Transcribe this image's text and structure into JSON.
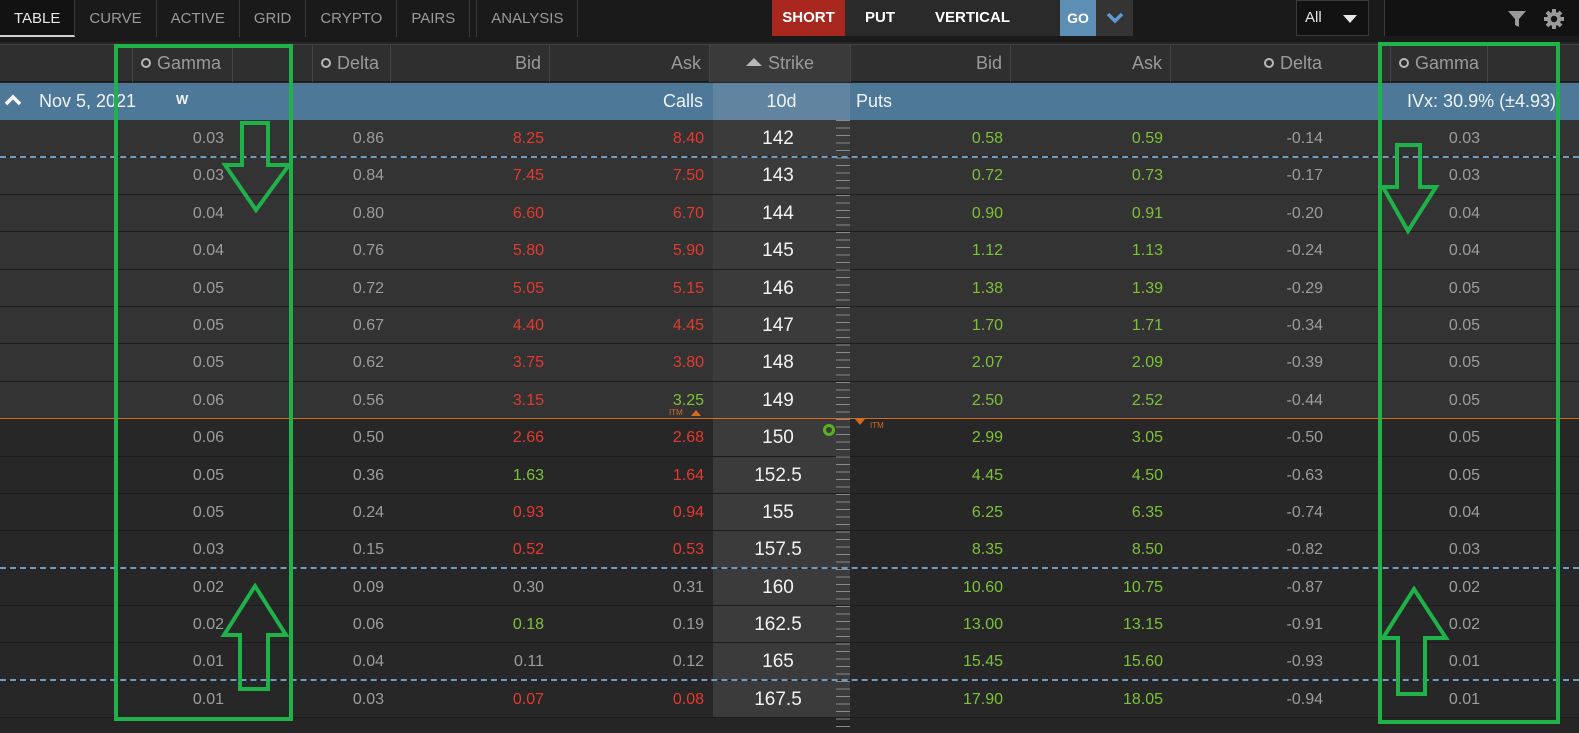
{
  "toolbar": {
    "tabs": [
      "TABLE",
      "CURVE",
      "ACTIVE",
      "GRID",
      "CRYPTO",
      "PAIRS",
      "ANALYSIS"
    ],
    "active_tab": "TABLE",
    "side_label": "SHORT",
    "type_label": "PUT",
    "spread_label": "VERTICAL",
    "go_label": "GO",
    "filter_select": "All"
  },
  "columns": {
    "call_gamma": "Gamma",
    "call_delta": "Delta",
    "call_bid": "Bid",
    "call_ask": "Ask",
    "strike": "Strike",
    "put_bid": "Bid",
    "put_ask": "Ask",
    "put_delta": "Delta",
    "put_gamma": "Gamma"
  },
  "expiration": {
    "date": "Nov 5, 2021",
    "tag": "W",
    "calls_label": "Calls",
    "days_to_exp": "10d",
    "puts_label": "Puts",
    "ivx": "IVx: 30.9% (±4.93)"
  },
  "itm_label": "ITM",
  "colors": {
    "highlight_box": "#1fb14a",
    "bid_ask_red": "#e23a2e",
    "bid_ask_green": "#7cc13a",
    "header_band": "#4e7897",
    "price_line": "#d86a1f"
  },
  "rows": [
    {
      "strike": "142",
      "c_gamma": "0.03",
      "c_delta": "0.86",
      "c_bid": "8.25",
      "c_bid_color": "red",
      "c_ask": "8.40",
      "c_ask_color": "red",
      "p_bid": "0.58",
      "p_ask": "0.59",
      "p_delta": "-0.14",
      "p_gamma": "0.03",
      "itm": true
    },
    {
      "strike": "143",
      "c_gamma": "0.03",
      "c_delta": "0.84",
      "c_bid": "7.45",
      "c_bid_color": "red",
      "c_ask": "7.50",
      "c_ask_color": "red",
      "p_bid": "0.72",
      "p_ask": "0.73",
      "p_delta": "-0.17",
      "p_gamma": "0.03",
      "itm": true
    },
    {
      "strike": "144",
      "c_gamma": "0.04",
      "c_delta": "0.80",
      "c_bid": "6.60",
      "c_bid_color": "red",
      "c_ask": "6.70",
      "c_ask_color": "red",
      "p_bid": "0.90",
      "p_ask": "0.91",
      "p_delta": "-0.20",
      "p_gamma": "0.04",
      "itm": true
    },
    {
      "strike": "145",
      "c_gamma": "0.04",
      "c_delta": "0.76",
      "c_bid": "5.80",
      "c_bid_color": "red",
      "c_ask": "5.90",
      "c_ask_color": "red",
      "p_bid": "1.12",
      "p_ask": "1.13",
      "p_delta": "-0.24",
      "p_gamma": "0.04",
      "itm": true
    },
    {
      "strike": "146",
      "c_gamma": "0.05",
      "c_delta": "0.72",
      "c_bid": "5.05",
      "c_bid_color": "red",
      "c_ask": "5.15",
      "c_ask_color": "red",
      "p_bid": "1.38",
      "p_ask": "1.39",
      "p_delta": "-0.29",
      "p_gamma": "0.05",
      "itm": true
    },
    {
      "strike": "147",
      "c_gamma": "0.05",
      "c_delta": "0.67",
      "c_bid": "4.40",
      "c_bid_color": "red",
      "c_ask": "4.45",
      "c_ask_color": "red",
      "p_bid": "1.70",
      "p_ask": "1.71",
      "p_delta": "-0.34",
      "p_gamma": "0.05",
      "itm": true
    },
    {
      "strike": "148",
      "c_gamma": "0.05",
      "c_delta": "0.62",
      "c_bid": "3.75",
      "c_bid_color": "red",
      "c_ask": "3.80",
      "c_ask_color": "red",
      "p_bid": "2.07",
      "p_ask": "2.09",
      "p_delta": "-0.39",
      "p_gamma": "0.05",
      "itm": true
    },
    {
      "strike": "149",
      "c_gamma": "0.06",
      "c_delta": "0.56",
      "c_bid": "3.15",
      "c_bid_color": "red",
      "c_ask": "3.25",
      "c_ask_color": "green",
      "p_bid": "2.50",
      "p_ask": "2.52",
      "p_delta": "-0.44",
      "p_gamma": "0.05",
      "itm": true
    },
    {
      "strike": "150",
      "c_gamma": "0.06",
      "c_delta": "0.50",
      "c_bid": "2.66",
      "c_bid_color": "red",
      "c_ask": "2.68",
      "c_ask_color": "red",
      "p_bid": "2.99",
      "p_ask": "3.05",
      "p_delta": "-0.50",
      "p_gamma": "0.05",
      "itm": false
    },
    {
      "strike": "152.5",
      "c_gamma": "0.05",
      "c_delta": "0.36",
      "c_bid": "1.63",
      "c_bid_color": "green",
      "c_ask": "1.64",
      "c_ask_color": "red",
      "p_bid": "4.45",
      "p_ask": "4.50",
      "p_delta": "-0.63",
      "p_gamma": "0.05",
      "itm": false
    },
    {
      "strike": "155",
      "c_gamma": "0.05",
      "c_delta": "0.24",
      "c_bid": "0.93",
      "c_bid_color": "red",
      "c_ask": "0.94",
      "c_ask_color": "red",
      "p_bid": "6.25",
      "p_ask": "6.35",
      "p_delta": "-0.74",
      "p_gamma": "0.04",
      "itm": false
    },
    {
      "strike": "157.5",
      "c_gamma": "0.03",
      "c_delta": "0.15",
      "c_bid": "0.52",
      "c_bid_color": "red",
      "c_ask": "0.53",
      "c_ask_color": "red",
      "p_bid": "8.35",
      "p_ask": "8.50",
      "p_delta": "-0.82",
      "p_gamma": "0.03",
      "itm": false
    },
    {
      "strike": "160",
      "c_gamma": "0.02",
      "c_delta": "0.09",
      "c_bid": "0.30",
      "c_bid_color": "gray",
      "c_ask": "0.31",
      "c_ask_color": "gray",
      "p_bid": "10.60",
      "p_ask": "10.75",
      "p_delta": "-0.87",
      "p_gamma": "0.02",
      "itm": false
    },
    {
      "strike": "162.5",
      "c_gamma": "0.02",
      "c_delta": "0.06",
      "c_bid": "0.18",
      "c_bid_color": "green",
      "c_ask": "0.19",
      "c_ask_color": "gray",
      "p_bid": "13.00",
      "p_ask": "13.15",
      "p_delta": "-0.91",
      "p_gamma": "0.02",
      "itm": false
    },
    {
      "strike": "165",
      "c_gamma": "0.01",
      "c_delta": "0.04",
      "c_bid": "0.11",
      "c_bid_color": "gray",
      "c_ask": "0.12",
      "c_ask_color": "gray",
      "p_bid": "15.45",
      "p_ask": "15.60",
      "p_delta": "-0.93",
      "p_gamma": "0.01",
      "itm": false
    },
    {
      "strike": "167.5",
      "c_gamma": "0.01",
      "c_delta": "0.03",
      "c_bid": "0.07",
      "c_bid_color": "red",
      "c_ask": "0.08",
      "c_ask_color": "red",
      "p_bid": "17.90",
      "p_ask": "18.05",
      "p_delta": "-0.94",
      "p_gamma": "0.01",
      "itm": false
    }
  ]
}
